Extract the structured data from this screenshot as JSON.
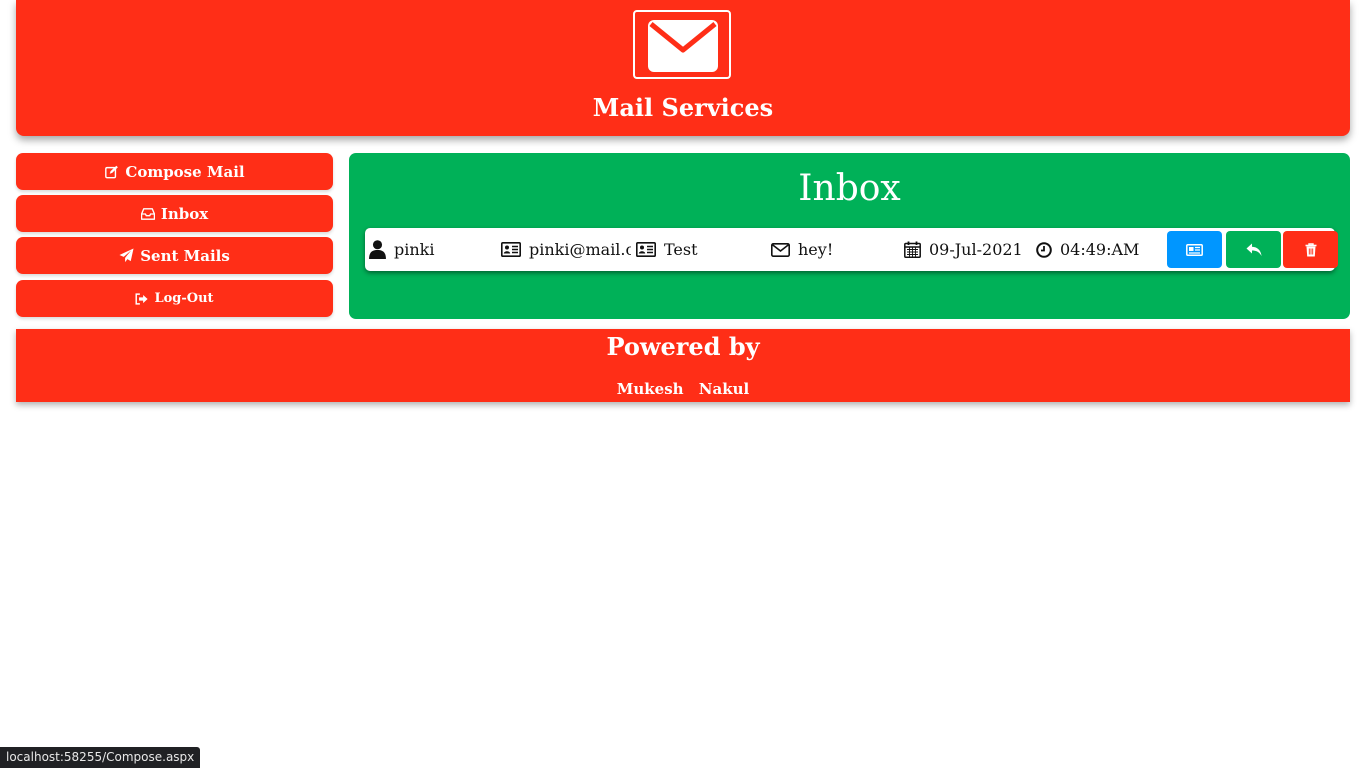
{
  "header": {
    "title": "Mail Services",
    "logo_icon": "envelope-icon"
  },
  "sidebar": {
    "items": [
      {
        "label": "Compose Mail",
        "icon": "edit-icon"
      },
      {
        "label": "Inbox",
        "icon": "inbox-icon"
      },
      {
        "label": "Sent Mails",
        "icon": "paper-plane-icon"
      },
      {
        "label": "Log-Out",
        "icon": "sign-out-icon"
      }
    ]
  },
  "main": {
    "title": "Inbox",
    "mails": [
      {
        "sender": "pinki",
        "email": "pinki@mail.co",
        "subject": "Test",
        "message": "hey!",
        "date": "09-Jul-2021",
        "time": "04:49:AM"
      }
    ],
    "actions": [
      {
        "name": "view",
        "icon": "newspaper-icon",
        "color": "#0096ff"
      },
      {
        "name": "reply",
        "icon": "reply-icon",
        "color": "#00b158"
      },
      {
        "name": "delete",
        "icon": "trash-icon",
        "color": "#ff2e17"
      }
    ]
  },
  "footer": {
    "title": "Powered by",
    "names": [
      "Mukesh",
      "Nakul"
    ]
  },
  "statusbar": {
    "url": "localhost:58255/Compose.aspx"
  },
  "colors": {
    "primary": "#ff2e17",
    "panel": "#00b158",
    "view": "#0096ff"
  }
}
